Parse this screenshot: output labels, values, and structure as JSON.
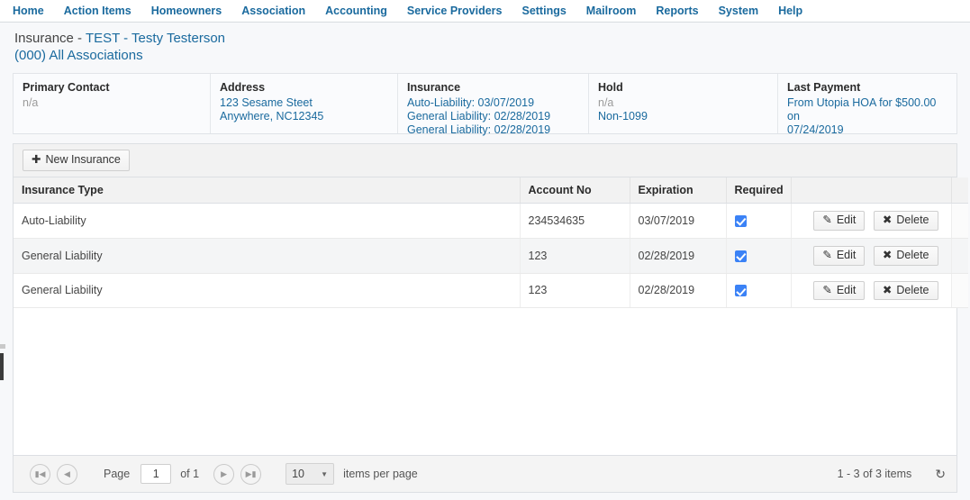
{
  "nav": {
    "items": [
      {
        "label": "Home",
        "name": "nav-home"
      },
      {
        "label": "Action Items",
        "name": "nav-action-items"
      },
      {
        "label": "Homeowners",
        "name": "nav-homeowners"
      },
      {
        "label": "Association",
        "name": "nav-association"
      },
      {
        "label": "Accounting",
        "name": "nav-accounting"
      },
      {
        "label": "Service Providers",
        "name": "nav-service-providers"
      },
      {
        "label": "Settings",
        "name": "nav-settings"
      },
      {
        "label": "Mailroom",
        "name": "nav-mailroom"
      },
      {
        "label": "Reports",
        "name": "nav-reports"
      },
      {
        "label": "System",
        "name": "nav-system"
      },
      {
        "label": "Help",
        "name": "nav-help"
      }
    ]
  },
  "page": {
    "title_prefix": "Insurance - ",
    "title_entity": "TEST - Testy Testerson",
    "subtitle": "(000) All Associations"
  },
  "info": {
    "primary_contact": {
      "title": "Primary Contact",
      "value": "n/a"
    },
    "address": {
      "title": "Address",
      "line1": "123 Sesame Steet",
      "line2": "Anywhere, NC12345"
    },
    "insurance": {
      "title": "Insurance",
      "line1": "Auto-Liability: 03/07/2019",
      "line2": "General Liability: 02/28/2019",
      "line3": "General Liability: 02/28/2019"
    },
    "hold": {
      "title": "Hold",
      "value": "n/a",
      "tax_status": "Non-1099"
    },
    "last_payment": {
      "title": "Last Payment",
      "line1": "From Utopia HOA for $500.00 on",
      "line2": "07/24/2019"
    }
  },
  "toolbar": {
    "new_insurance_label": "New Insurance",
    "new_insurance_icon": "plus-icon"
  },
  "table": {
    "columns": [
      {
        "label": "Insurance Type",
        "name": "column-insurance-type"
      },
      {
        "label": "Account No",
        "name": "column-account-no"
      },
      {
        "label": "Expiration",
        "name": "column-expiration"
      },
      {
        "label": "Required",
        "name": "column-required"
      },
      {
        "label": "",
        "name": "column-actions"
      }
    ],
    "rows": [
      {
        "insurance_type": "Auto-Liability",
        "account_no": "234534635",
        "expiration": "03/07/2019",
        "required": true,
        "edit_label": "Edit",
        "delete_label": "Delete"
      },
      {
        "insurance_type": "General Liability",
        "account_no": "123",
        "expiration": "02/28/2019",
        "required": true,
        "edit_label": "Edit",
        "delete_label": "Delete"
      },
      {
        "insurance_type": "General Liability",
        "account_no": "123",
        "expiration": "02/28/2019",
        "required": true,
        "edit_label": "Edit",
        "delete_label": "Delete"
      }
    ]
  },
  "pager": {
    "first_icon": "first-page-icon",
    "prev_icon": "previous-page-icon",
    "next_icon": "next-page-icon",
    "last_icon": "last-page-icon",
    "page_label": "Page",
    "page_value": "1",
    "of_label": "of 1",
    "items_per_page_value": "10",
    "items_per_page_label": "items per page",
    "items_summary": "1 - 3 of 3 items",
    "refresh_icon": "refresh-icon"
  },
  "colors": {
    "nav_link": "#1a6a9e",
    "link": "#1a6a9e",
    "checkbox_checked": "#3b82f6",
    "page_background": "#f7f8fa",
    "toolbar_background": "#f2f2f2"
  }
}
